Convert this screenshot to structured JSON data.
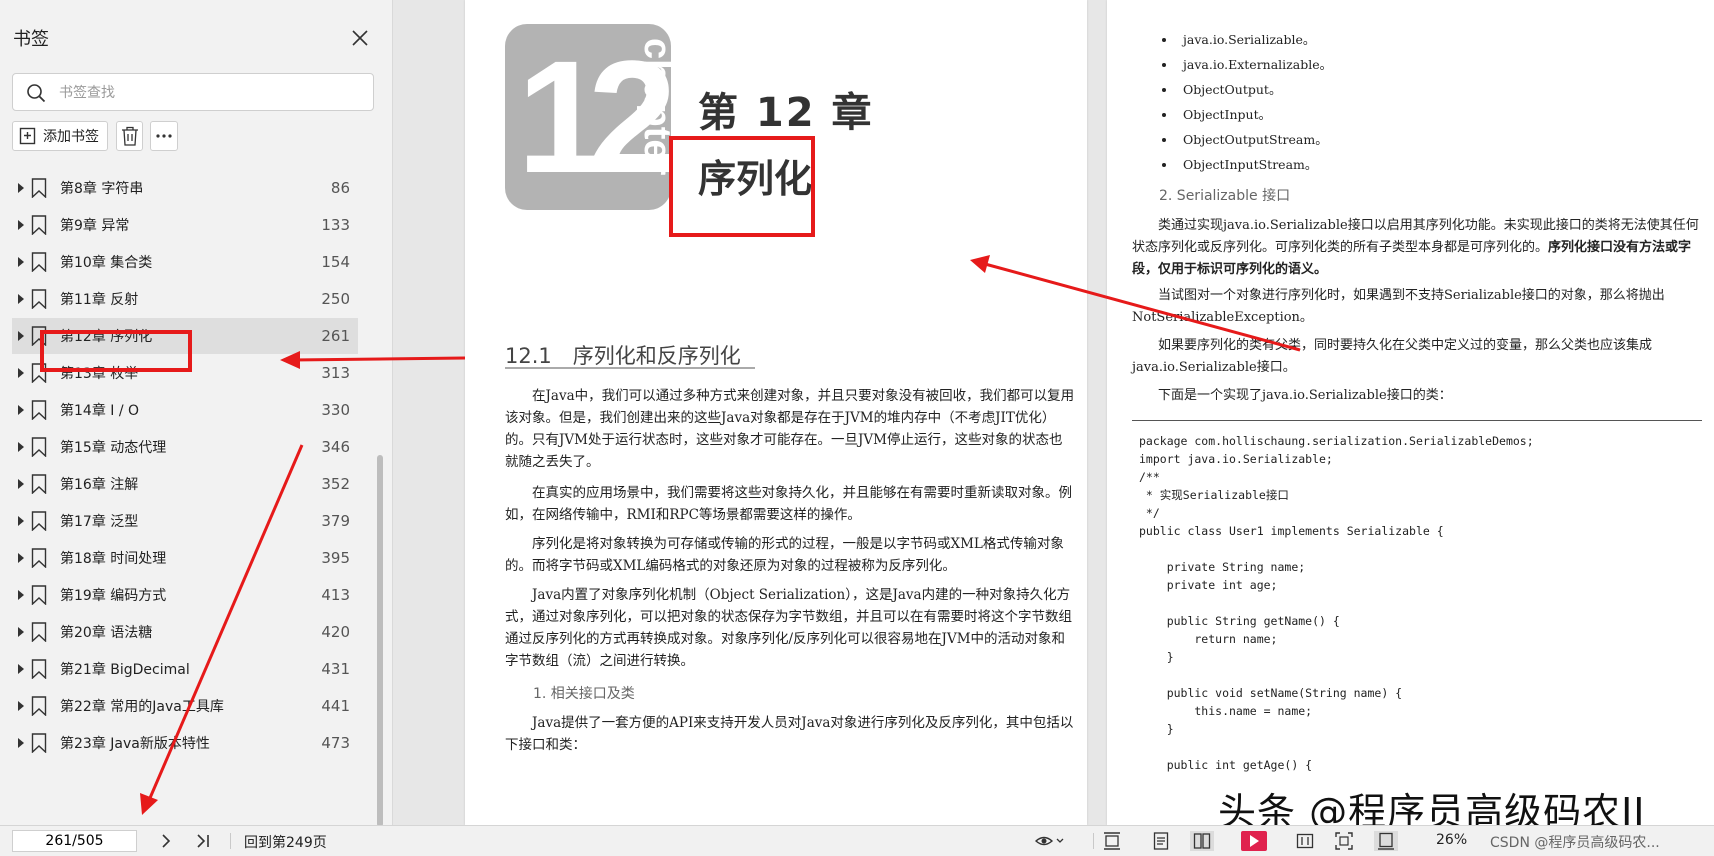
{
  "sidebar": {
    "title": "书签",
    "search_placeholder": "书签查找",
    "add_label": "添加书签",
    "items": [
      {
        "label": "第8章 字符串",
        "page": "86"
      },
      {
        "label": "第9章 异常",
        "page": "133"
      },
      {
        "label": "第10章 集合类",
        "page": "154"
      },
      {
        "label": "第11章 反射",
        "page": "250"
      },
      {
        "label": "第12章 序列化",
        "page": "261"
      },
      {
        "label": "第13章 枚举",
        "page": "313"
      },
      {
        "label": "第14章 I / O",
        "page": "330"
      },
      {
        "label": "第15章 动态代理",
        "page": "346"
      },
      {
        "label": "第16章 注解",
        "page": "352"
      },
      {
        "label": "第17章 泛型",
        "page": "379"
      },
      {
        "label": "第18章 时间处理",
        "page": "395"
      },
      {
        "label": "第19章 编码方式",
        "page": "413"
      },
      {
        "label": "第20章 语法糖",
        "page": "420"
      },
      {
        "label": "第21章 BigDecimal",
        "page": "431"
      },
      {
        "label": "第22章 常用的Java工具库",
        "page": "441"
      },
      {
        "label": "第23章 Java新版本特性",
        "page": "473"
      }
    ]
  },
  "left_page": {
    "chapter_num": "12",
    "chapter_word": "chapter",
    "chapter_title": "第 12 章",
    "chapter_name": "序列化",
    "section_heading": "12.1　序列化和反序列化",
    "p1": "在Java中，我们可以通过多种方式来创建对象，并且只要对象没有被回收，我们都可以复用该对象。但是，我们创建出来的这些Java对象都是存在于JVM的堆内存中（不考虑JIT优化）的。只有JVM处于运行状态时，这些对象才可能存在。一旦JVM停止运行，这些对象的状态也就随之丢失了。",
    "p2": "在真实的应用场景中，我们需要将这些对象持久化，并且能够在有需要时重新读取对象。例如，在网络传输中，RMI和RPC等场景都需要这样的操作。",
    "p3": "序列化是将对象转换为可存储或传输的形式的过程，一般是以字节码或XML格式传输对象的。而将字节码或XML编码格式的对象还原为对象的过程被称为反序列化。",
    "p4": "Java内置了对象序列化机制（Object Serialization），这是Java内建的一种对象持久化方式，通过对象序列化，可以把对象的状态保存为字节数组，并且可以在有需要时将这个字节数组通过反序列化的方式再转换成对象。对象序列化/反序列化可以很容易地在JVM中的活动对象和字节数组（流）之间进行转换。",
    "sub_heading": "1. 相关接口及类",
    "p5": "Java提供了一套方便的API来支持开发人员对Java对象进行序列化及反序列化，其中包括以下接口和类："
  },
  "right_page": {
    "bullets": [
      "java.io.Serializable。",
      "java.io.Externalizable。",
      "ObjectOutput。",
      "ObjectInput。",
      "ObjectOutputStream。",
      "ObjectInputStream。"
    ],
    "sub_heading": "2. Serializable 接口",
    "p1_normal": "类通过实现java.io.Serializable接口以启用其序列化功能。未实现此接口的类将无法使其任何状态序列化或反序列化。可序列化类的所有子类型本身都是可序列化的。",
    "p1_bold": "序列化接口没有方法或字段，仅用于标识可序列化的语义。",
    "p2": "当试图对一个对象进行序列化时，如果遇到不支持Serializable接口的对象，那么将抛出NotSerializableException。",
    "p3": "如果要序列化的类有父类，同时要持久化在父类中定义过的变量，那么父类也应该集成java.io.Serializable接口。",
    "p4": "下面是一个实现了java.io.Serializable接口的类：",
    "code": "package com.hollischaung.serialization.SerializableDemos;\nimport java.io.Serializable;\n/**\n * 实现Serializable接口\n */\npublic class User1 implements Serializable {\n\n    private String name;\n    private int age;\n\n    public String getName() {\n        return name;\n    }\n\n    public void setName(String name) {\n        this.name = name;\n    }\n\n    public int getAge() {"
  },
  "watermark": "头条 @程序员高级码农II",
  "bottom_bar": {
    "page_indicator": "261/505",
    "back_label": "回到第249页",
    "zoom": "26%",
    "csdn": "CSDN @程序员高级码农..."
  },
  "colors": {
    "highlight_red": "#e61a1a",
    "play_button": "#e0224e",
    "selected_row": "#dedede"
  }
}
